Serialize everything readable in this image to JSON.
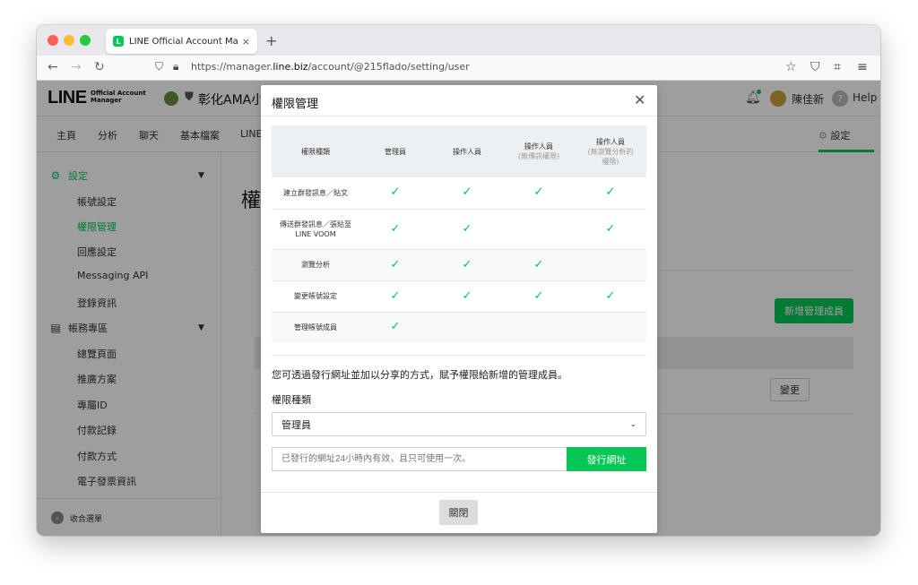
{
  "browser": {
    "tab_title": "LINE Official Account Manager",
    "tab_close": "×",
    "new_tab": "+",
    "url_prefix": "https://manager.",
    "url_domain": "line.biz",
    "url_path": "/account/@215flado/setting/user"
  },
  "header": {
    "logo": "LINE",
    "logo_sub_1": "Official Account",
    "logo_sub_2": "Manager",
    "account_name": "彰化AMA小",
    "user_name": "陳佳新",
    "help": "Help"
  },
  "main_nav": {
    "items": [
      "主頁",
      "分析",
      "聊天",
      "基本檔案",
      "LINE"
    ],
    "settings": "設定"
  },
  "sidebar": {
    "section_settings": "設定",
    "settings_items": [
      "帳號設定",
      "權限管理",
      "回應設定",
      "Messaging API",
      "登錄資訊"
    ],
    "section_account": "帳務專區",
    "account_items": [
      "總覽頁面",
      "推廣方案",
      "專屬ID",
      "付款記錄",
      "付款方式",
      "電子發票資訊"
    ],
    "collapse": "收合選單"
  },
  "background": {
    "title_char": "權",
    "new_admin_button": "新增管理成員",
    "change_button": "變更"
  },
  "modal": {
    "title": "權限管理",
    "table": {
      "headers": [
        {
          "title": "權限種類",
          "sub": ""
        },
        {
          "title": "管理員",
          "sub": ""
        },
        {
          "title": "操作人員",
          "sub": ""
        },
        {
          "title": "操作人員",
          "sub": "(無傳訊權限)"
        },
        {
          "title": "操作人員",
          "sub": "(無瀏覽分析的權限)"
        }
      ],
      "rows": [
        {
          "label": "建立群發訊息／貼文",
          "checks": [
            true,
            true,
            true,
            true
          ]
        },
        {
          "label": "傳送群發訊息／張貼至LINE VOOM",
          "checks": [
            true,
            true,
            false,
            true
          ]
        },
        {
          "label": "瀏覽分析",
          "checks": [
            true,
            true,
            true,
            false
          ]
        },
        {
          "label": "變更帳號設定",
          "checks": [
            true,
            true,
            true,
            true
          ]
        },
        {
          "label": "管理帳號成員",
          "checks": [
            true,
            false,
            false,
            false
          ]
        }
      ]
    },
    "description": "您可透過發行網址並加以分享的方式，賦予權限給新增的管理成員。",
    "select_label": "權限種類",
    "select_value": "管理員",
    "url_placeholder": "已發行的網址24小時內有效，且只可使用一次。",
    "issue_button": "發行網址",
    "close_button": "關閉"
  },
  "colors": {
    "accent": "#06c755",
    "traffic_red": "#fe5f57",
    "traffic_yellow": "#febc2e",
    "traffic_green": "#28c840"
  }
}
